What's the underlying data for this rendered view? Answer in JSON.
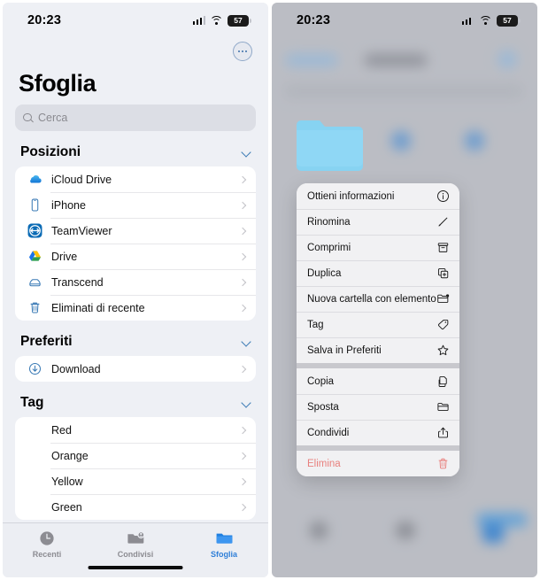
{
  "left_phone": {
    "status_bar": {
      "time": "20:23",
      "battery_level": "57",
      "signal_icon": "cellular-signal-icon",
      "wifi_icon": "wifi-icon",
      "battery_icon": "battery-icon"
    },
    "more_button": {
      "icon": "ellipsis-circle-icon"
    },
    "title": "Sfoglia",
    "search": {
      "placeholder": "Cerca",
      "icon": "search-icon"
    },
    "sections": [
      {
        "title": "Posizioni",
        "collapse_icon": "chevron-down-icon",
        "items": [
          {
            "label": "iCloud Drive",
            "icon": "icloud-drive-icon"
          },
          {
            "label": "iPhone",
            "icon": "iphone-icon"
          },
          {
            "label": "TeamViewer",
            "icon": "teamviewer-icon"
          },
          {
            "label": "Drive",
            "icon": "google-drive-icon"
          },
          {
            "label": "Transcend",
            "icon": "external-drive-icon"
          },
          {
            "label": "Eliminati di recente",
            "icon": "trash-icon"
          }
        ]
      },
      {
        "title": "Preferiti",
        "collapse_icon": "chevron-down-icon",
        "items": [
          {
            "label": "Download",
            "icon": "download-circle-icon"
          }
        ]
      },
      {
        "title": "Tag",
        "collapse_icon": "chevron-down-icon",
        "items": [
          {
            "label": "Red",
            "icon": "tag-dot-icon",
            "color": "#ef3b36"
          },
          {
            "label": "Orange",
            "icon": "tag-dot-icon",
            "color": "#f08015"
          },
          {
            "label": "Yellow",
            "icon": "tag-dot-icon",
            "color": "#f7c51a"
          },
          {
            "label": "Green",
            "icon": "tag-dot-icon",
            "color": "#2fb74c"
          }
        ]
      }
    ],
    "tab_bar": {
      "tabs": [
        {
          "label": "Recenti",
          "icon": "clock-icon",
          "active": false
        },
        {
          "label": "Condivisi",
          "icon": "shared-folder-icon",
          "active": false
        },
        {
          "label": "Sfoglia",
          "icon": "folder-icon",
          "active": true
        }
      ]
    }
  },
  "right_phone": {
    "status_bar": {
      "time": "20:23",
      "battery_level": "57",
      "signal_icon": "cellular-signal-icon",
      "wifi_icon": "wifi-icon",
      "battery_icon": "battery-icon"
    },
    "selected_item": {
      "icon": "folder-icon",
      "color": "#87d3f2"
    },
    "context_menu": {
      "groups": [
        {
          "items": [
            {
              "label": "Ottieni informazioni",
              "icon": "info-circle-icon",
              "destructive": false
            },
            {
              "label": "Rinomina",
              "icon": "pencil-icon",
              "destructive": false
            },
            {
              "label": "Comprimi",
              "icon": "archive-box-icon",
              "destructive": false
            },
            {
              "label": "Duplica",
              "icon": "duplicate-icon",
              "destructive": false
            },
            {
              "label": "Nuova cartella con elemento",
              "icon": "new-folder-icon",
              "destructive": false
            },
            {
              "label": "Tag",
              "icon": "tag-icon",
              "destructive": false
            },
            {
              "label": "Salva in Preferiti",
              "icon": "star-icon",
              "destructive": false
            }
          ]
        },
        {
          "items": [
            {
              "label": "Copia",
              "icon": "copy-icon",
              "destructive": false
            },
            {
              "label": "Sposta",
              "icon": "folder-move-icon",
              "destructive": false
            },
            {
              "label": "Condividi",
              "icon": "share-icon",
              "destructive": false
            }
          ]
        },
        {
          "items": [
            {
              "label": "Elimina",
              "icon": "trash-icon",
              "destructive": true
            }
          ]
        }
      ]
    }
  }
}
